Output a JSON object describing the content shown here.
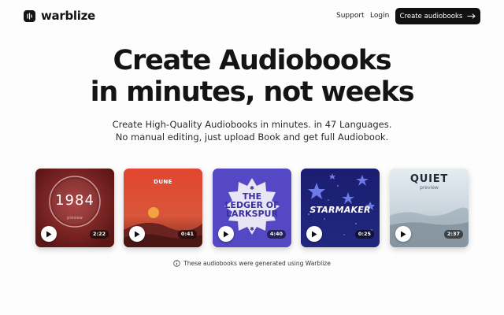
{
  "brand": {
    "name": "warblize",
    "logo_icon": "waveform-icon"
  },
  "nav": {
    "support": "Support",
    "login": "Login",
    "cta": "Create audiobooks",
    "cta_icon": "arrow-right-icon"
  },
  "hero": {
    "line1": "Create Audiobooks",
    "line2": "in minutes, not weeks",
    "sub1": "Create High-Quality Audiobooks in minutes. in 47 Languages.",
    "sub2": "No manual editing, just upload Book and get full Audiobook."
  },
  "books": [
    {
      "title": "1984",
      "subtitle": "preview",
      "duration": "2:22",
      "color": "#8d2a2a"
    },
    {
      "title": "DUNE",
      "duration": "0:41",
      "color": "#e1452f"
    },
    {
      "title": "THE\nLEDGER OF\nLARKSPUR",
      "duration": "4:40",
      "color": "#5b4fc8"
    },
    {
      "title": "STARMAKER",
      "duration": "0:25",
      "color": "#1b1f6e"
    },
    {
      "title": "QUIET",
      "subtitle": "preview",
      "duration": "2:37",
      "color": "#dfe6eb"
    }
  ],
  "note": {
    "text": "These audiobooks were generated using Warblize",
    "icon": "info-icon"
  }
}
